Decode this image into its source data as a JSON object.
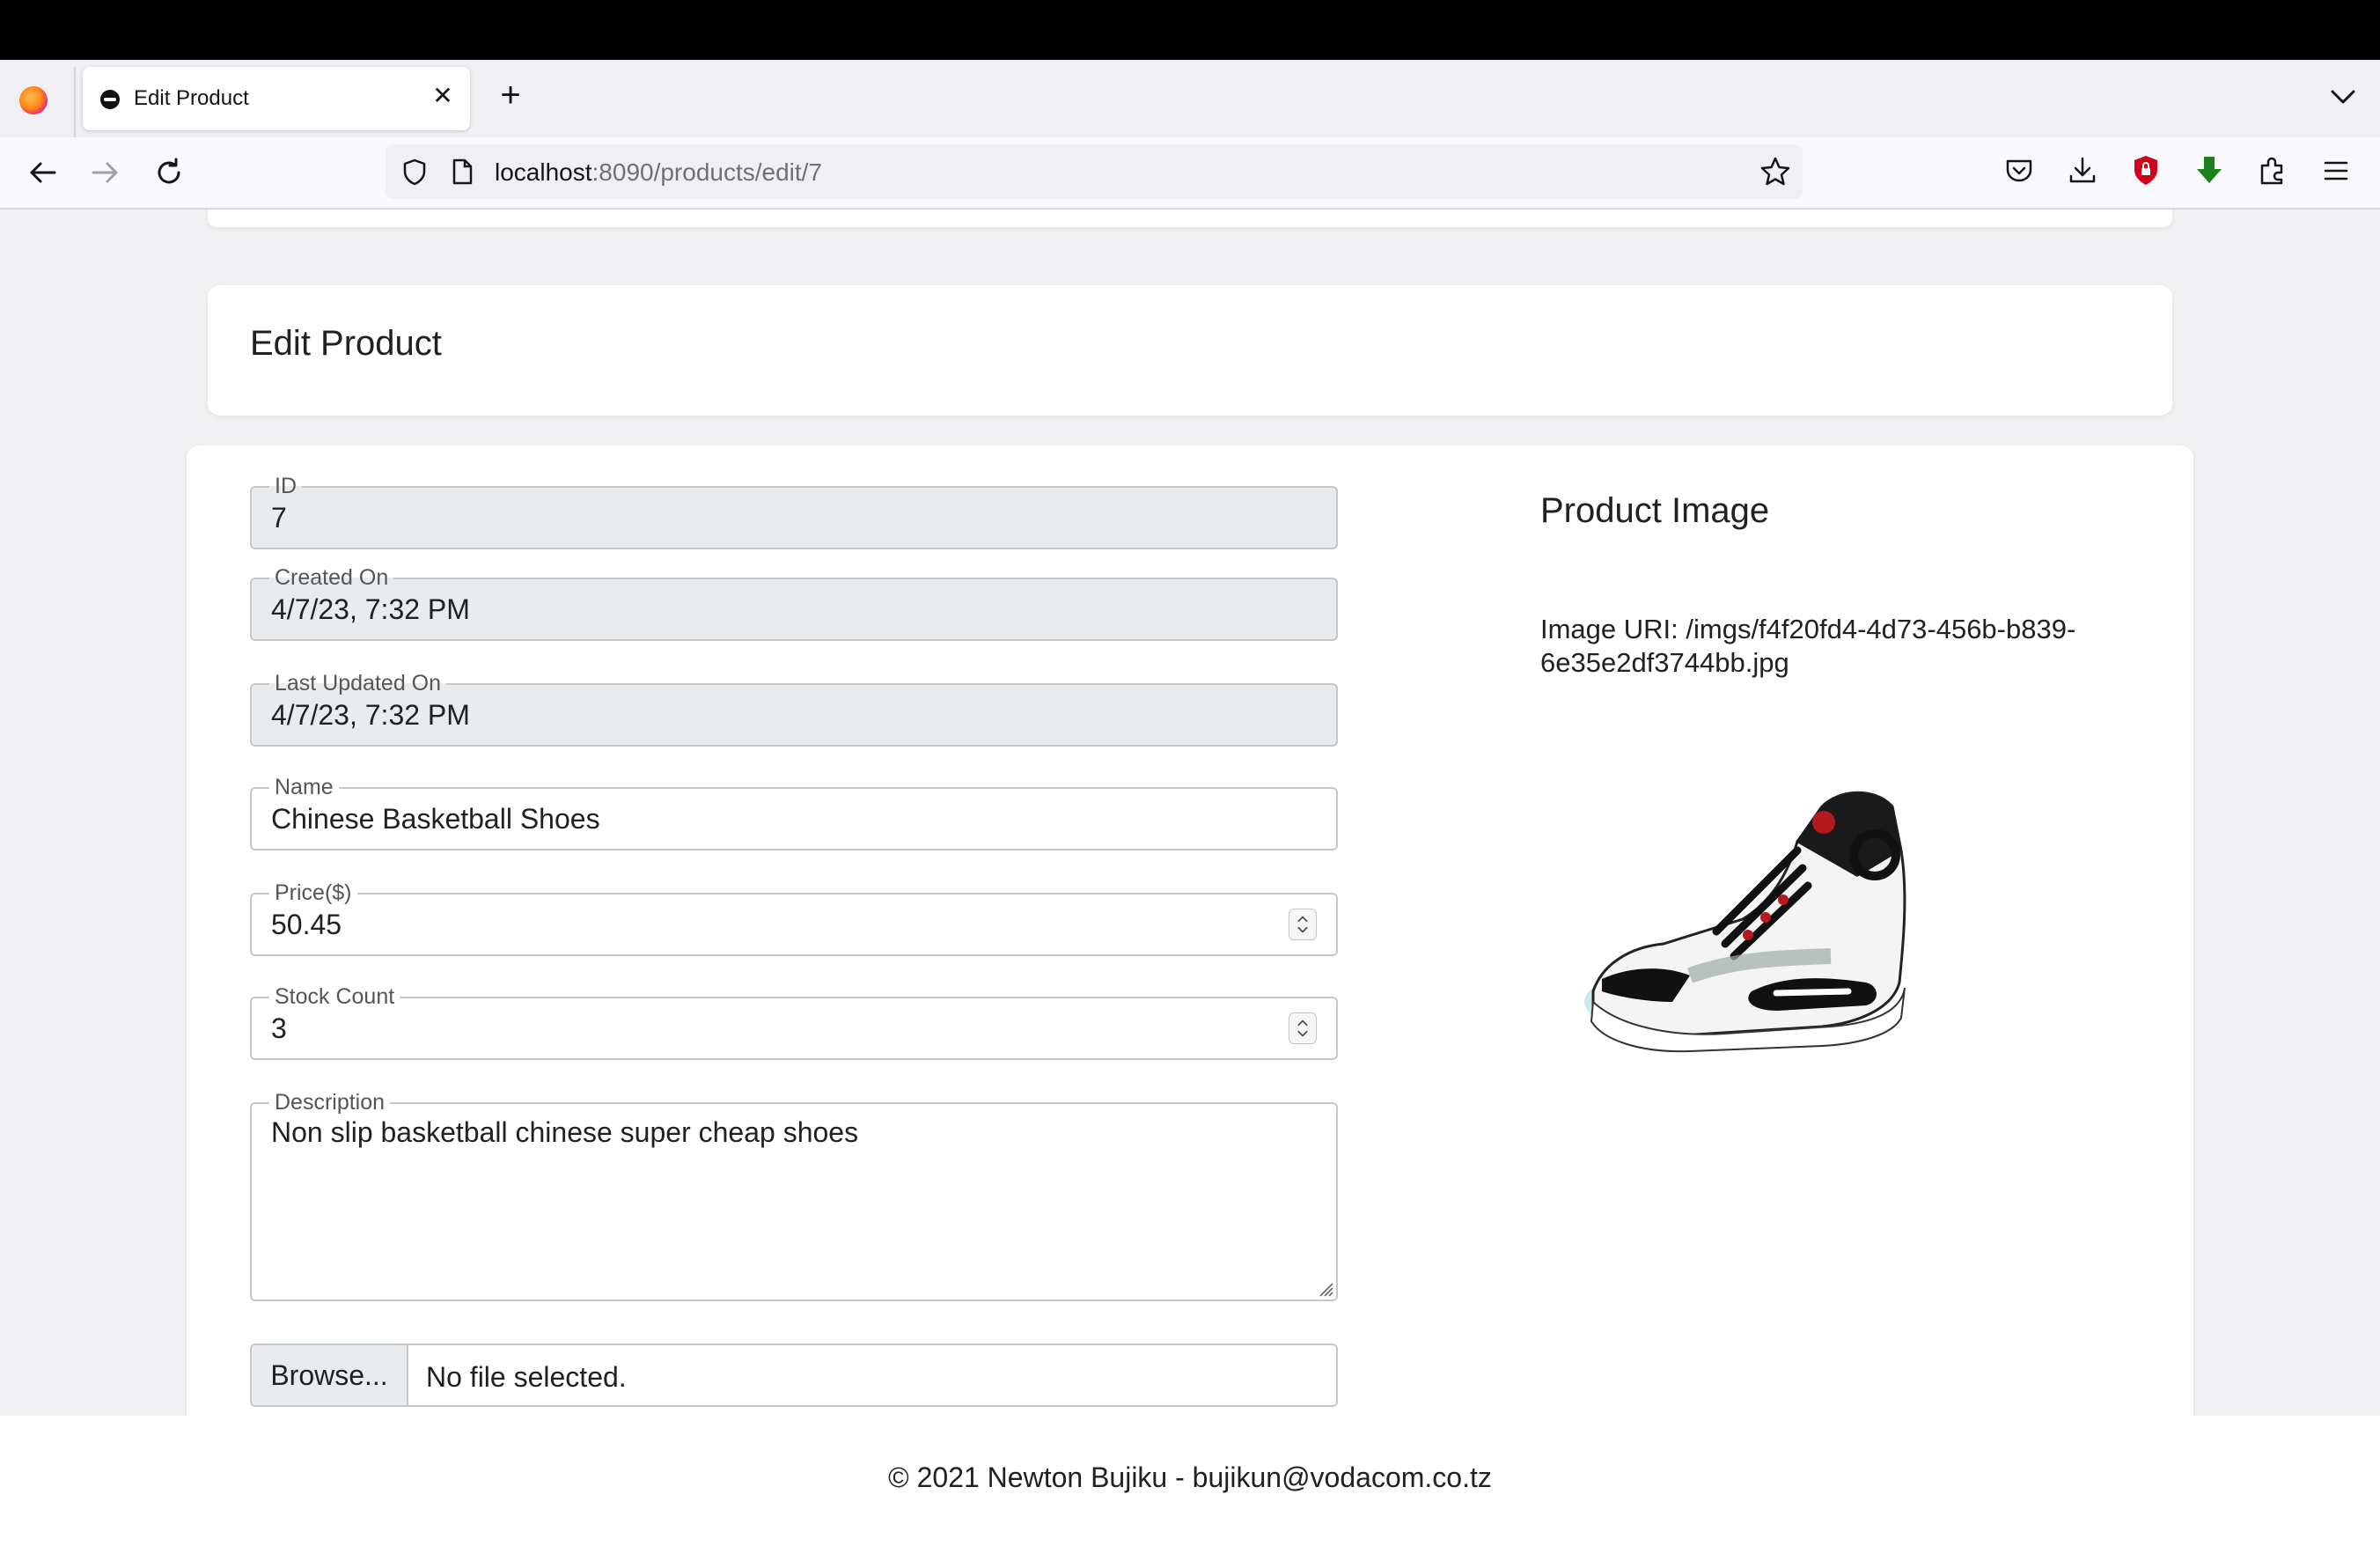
{
  "browser": {
    "tab_title": "Edit Product",
    "url_host": "localhost",
    "url_path": ":8090/products/edit/7",
    "icons": [
      "firefox-logo",
      "back-arrow",
      "forward-arrow",
      "reload",
      "shield",
      "page",
      "star",
      "pocket",
      "download",
      "ublock",
      "download-green",
      "extensions",
      "menu"
    ]
  },
  "header": {
    "title": "Edit Product"
  },
  "form": {
    "id": {
      "label": "ID",
      "value": "7"
    },
    "created_on": {
      "label": "Created On",
      "value": "4/7/23, 7:32 PM"
    },
    "last_updated_on": {
      "label": "Last Updated On",
      "value": "4/7/23, 7:32 PM"
    },
    "name": {
      "label": "Name",
      "value": "Chinese Basketball Shoes"
    },
    "price": {
      "label": "Price($)",
      "value": "50.45"
    },
    "stock_count": {
      "label": "Stock Count",
      "value": "3"
    },
    "description": {
      "label": "Description",
      "value": "Non slip basketball chinese super cheap shoes"
    },
    "file": {
      "button_label": "Browse...",
      "status": "No file selected."
    }
  },
  "product_image": {
    "heading": "Product Image",
    "uri_text": "Image URI: /imgs/f4f20fd4-4d73-456b-b839-6e35e2df3744bb.jpg"
  },
  "footer": {
    "text": "© 2021 Newton Bujiku - bujikun@vodacom.co.tz"
  }
}
